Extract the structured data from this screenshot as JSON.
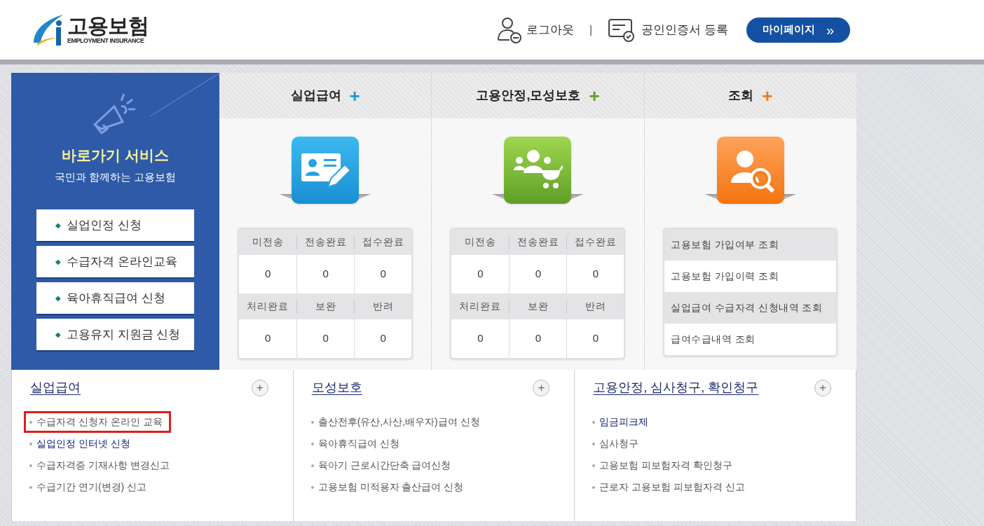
{
  "header": {
    "logo": {
      "title": "고용보험",
      "subtitle": "EMPLOYMENT INSURANCE"
    },
    "logout": "로그아웃",
    "separator": "|",
    "certificate": "공인인증서 등록",
    "mypage": "마이페이지",
    "mypage_arrow": "»"
  },
  "quick": {
    "title": "바로가기 서비스",
    "subtitle": "국민과 함께하는 고용보험",
    "items": [
      "실업인정 신청",
      "수급자격 온라인교육",
      "육아휴직급여 신청",
      "고용유지 지원금 신청"
    ],
    "bullet": "◆"
  },
  "columns": [
    {
      "title": "실업급여",
      "plus": "+",
      "color": "#1a9ad6",
      "kind": "counts",
      "rows": [
        {
          "labels": [
            "미전송",
            "전송완료",
            "접수완료"
          ],
          "values": [
            "0",
            "0",
            "0"
          ]
        },
        {
          "labels": [
            "처리완료",
            "보완",
            "반려"
          ],
          "values": [
            "0",
            "0",
            "0"
          ]
        }
      ]
    },
    {
      "title": "고용안정,모성보호",
      "plus": "+",
      "color": "#5ba12a",
      "kind": "counts",
      "rows": [
        {
          "labels": [
            "미전송",
            "전송완료",
            "접수완료"
          ],
          "values": [
            "0",
            "0",
            "0"
          ]
        },
        {
          "labels": [
            "처리완료",
            "보완",
            "반려"
          ],
          "values": [
            "0",
            "0",
            "0"
          ]
        }
      ]
    },
    {
      "title": "조회",
      "plus": "+",
      "color": "#f07b1c",
      "kind": "list",
      "items": [
        "고용보험 가입여부 조회",
        "고용보험 가입이력 조회",
        "실업급여 수급자격 신청내역 조회",
        "급여수급내역 조회"
      ]
    }
  ],
  "sections": [
    {
      "title": "실업급여",
      "more": "+",
      "links": [
        {
          "text": "수급자격 신청자 온라인 교육",
          "emphasized": false,
          "outlined": true
        },
        {
          "text": "실업인정 인터넷 신청",
          "emphasized": true,
          "outlined": false
        },
        {
          "text": "수급자격증 기재사항 변경신고",
          "emphasized": false,
          "outlined": false
        },
        {
          "text": "수급기간 연기(변경) 신고",
          "emphasized": false,
          "outlined": false
        }
      ]
    },
    {
      "title": "모성보호",
      "more": "+",
      "links": [
        {
          "text": "출산전후(유산,사산,배우자)급여 신청",
          "emphasized": false,
          "outlined": false
        },
        {
          "text": "육아휴직급여 신청",
          "emphasized": false,
          "outlined": false
        },
        {
          "text": "육아기 근로시간단축 급여신청",
          "emphasized": false,
          "outlined": false
        },
        {
          "text": "고용보험 미적용자 출산급여 신청",
          "emphasized": false,
          "outlined": false
        }
      ]
    },
    {
      "title": "고용안정, 심사청구, 확인청구",
      "more": "+",
      "links": [
        {
          "text": "임금피크제",
          "emphasized": true,
          "outlined": false
        },
        {
          "text": "심사청구",
          "emphasized": false,
          "outlined": false
        },
        {
          "text": "고용보험 피보험자격 확인청구",
          "emphasized": false,
          "outlined": false
        },
        {
          "text": "근로자 고용보험 피보험자격 신고",
          "emphasized": false,
          "outlined": false
        }
      ]
    }
  ]
}
